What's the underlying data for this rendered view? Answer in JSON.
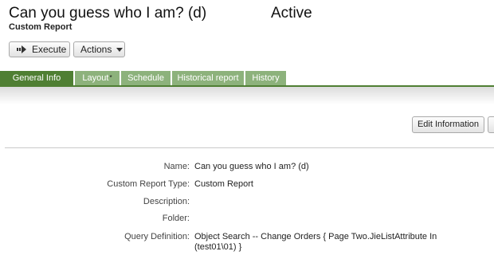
{
  "header": {
    "title": "Can you guess who I am? (d)",
    "status": "Active",
    "subtitle": "Custom Report"
  },
  "toolbar": {
    "execute_label": "Execute",
    "actions_label": "Actions"
  },
  "tabs": [
    {
      "label": "General Info",
      "active": true
    },
    {
      "label": "Layout",
      "marker": "*"
    },
    {
      "label": "Schedule"
    },
    {
      "label": "Historical report"
    },
    {
      "label": "History"
    }
  ],
  "details": {
    "edit_button_label": "Edit Information",
    "fields": [
      {
        "label": "Name:",
        "value": "Can you guess who I am? (d)"
      },
      {
        "label": "Custom Report Type:",
        "value": "Custom Report"
      },
      {
        "label": "Description:",
        "value": ""
      },
      {
        "label": "Folder:",
        "value": ""
      },
      {
        "label": "Query Definition:",
        "value": "Object Search -- Change Orders {  Page Two.JieListAttribute In (test01\\01)  }"
      }
    ]
  },
  "colors": {
    "tab_active": "#4f7f33",
    "tab_inactive": "#8db27c"
  },
  "icons": {
    "execute": "execute-arrow-icon",
    "actions": "chevron-down-icon"
  }
}
